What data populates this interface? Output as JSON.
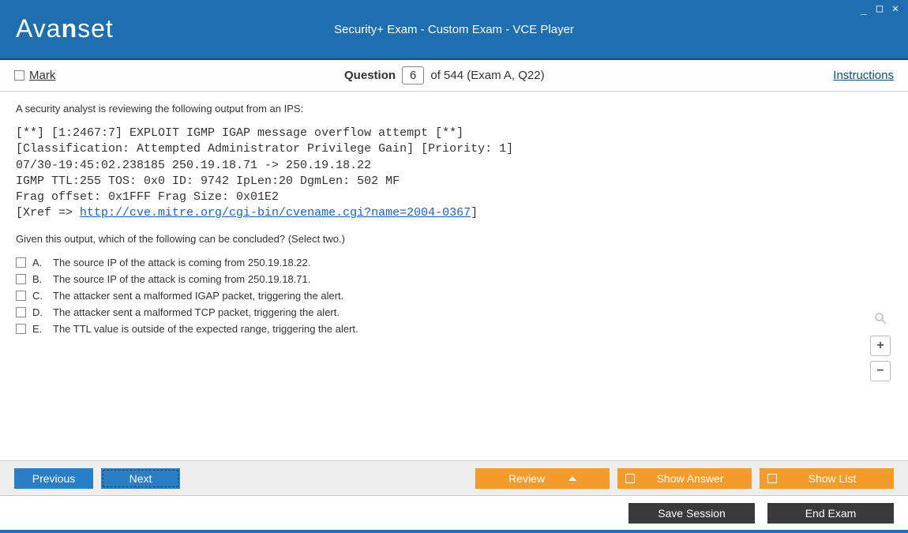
{
  "titlebar": {
    "logo_text": "Avanset",
    "title": "Security+ Exam - Custom Exam - VCE Player"
  },
  "qheader": {
    "mark_label": "Mark",
    "question_word": "Question",
    "question_num": "6",
    "of_text": "of 544 (Exam A, Q22)",
    "instructions": "Instructions"
  },
  "question": {
    "stem": "A security analyst is reviewing the following output from an IPS:",
    "code_line1": "[**] [1:2467:7] EXPLOIT IGMP IGAP message overflow attempt [**]",
    "code_line2": "[Classification: Attempted Administrator Privilege Gain] [Priority: 1]",
    "code_line3": "07/30-19:45:02.238185 250.19.18.71 -> 250.19.18.22",
    "code_line4": "IGMP TTL:255 TOS: 0x0 ID: 9742 IpLen:20 DgmLen: 502 MF",
    "code_line5": "Frag offset: 0x1FFF Frag Size: 0x01E2",
    "code_xref_prefix": "[Xref => ",
    "code_xref_link": "http://cve.mitre.org/cgi-bin/cvename.cgi?name=2004-0367",
    "code_xref_suffix": "]",
    "prompt": "Given this output, which of the following can be concluded? (Select two.)",
    "options": [
      {
        "letter": "A.",
        "text": "The source IP of the attack is coming from 250.19.18.22."
      },
      {
        "letter": "B.",
        "text": "The source IP of the attack is coming from 250.19.18.71."
      },
      {
        "letter": "C.",
        "text": "The attacker sent a malformed IGAP packet, triggering the alert."
      },
      {
        "letter": "D.",
        "text": "The attacker sent a malformed TCP packet, triggering the alert."
      },
      {
        "letter": "E.",
        "text": "The TTL value is outside of the expected range, triggering the alert."
      }
    ]
  },
  "footer": {
    "previous": "Previous",
    "next": "Next",
    "review": "Review",
    "show_answer": "Show Answer",
    "show_list": "Show List",
    "save_session": "Save Session",
    "end_exam": "End Exam"
  },
  "zoom": {
    "plus": "+",
    "minus": "−"
  }
}
